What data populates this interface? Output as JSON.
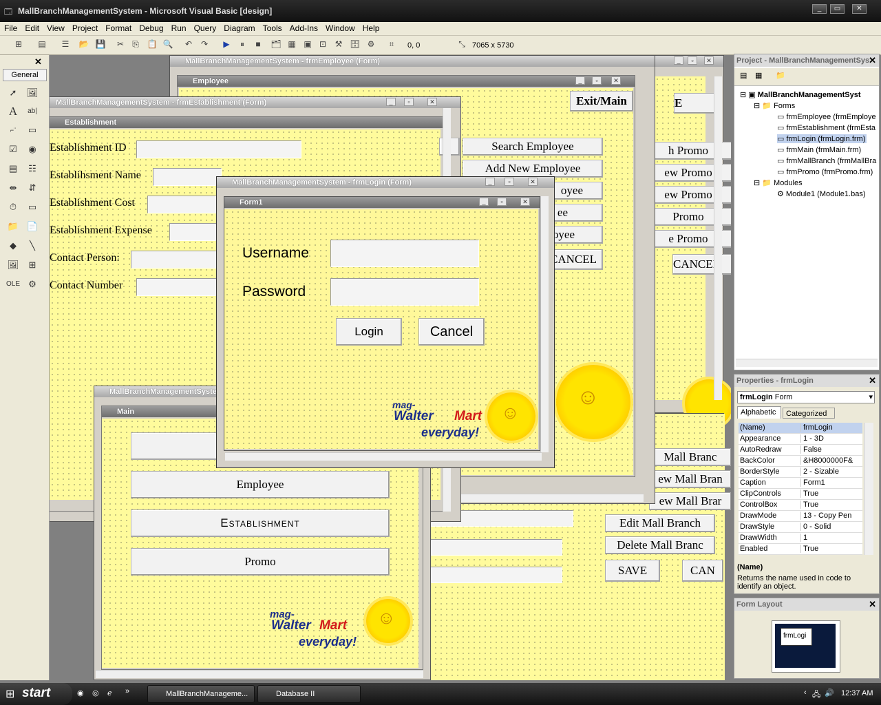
{
  "app": {
    "title": "MallBranchManagementSystem - Microsoft Visual Basic [design]"
  },
  "menu": [
    "File",
    "Edit",
    "View",
    "Project",
    "Format",
    "Debug",
    "Run",
    "Query",
    "Diagram",
    "Tools",
    "Add-Ins",
    "Window",
    "Help"
  ],
  "toolbar": {
    "position": "0, 0",
    "size": "7065 x 5730"
  },
  "toolbox": {
    "title": "General"
  },
  "windows": {
    "employee": {
      "mdi_title": "MallBranchManagementSystem - frmEmployee (Form)",
      "title": "Employee",
      "exit_label": "Exit/Main",
      "buttons": [
        "Search Employee",
        "Add New Employee",
        "oyee",
        "ee",
        "oyee",
        "CANCEL"
      ]
    },
    "promo": {
      "buttons": [
        "h Promo",
        "ew Promo",
        "ew Promo",
        "Promo",
        "e Promo",
        "CANCEI"
      ],
      "b_label": "E"
    },
    "mallbranch": {
      "buttons": [
        "Mall Branc",
        "ew Mall Bran",
        "ew Mall Brar",
        "Edit Mall Branch",
        "Delete Mall Branc",
        "SAVE",
        "CAN"
      ]
    },
    "establishment": {
      "mdi_title": "MallBranchManagementSystem - frmEstablishment (Form)",
      "title": "Establishment",
      "fields": [
        "Establishment ID",
        "Establihsment Name",
        "Establishment Cost",
        "Establishment Expense",
        "Contact Person:",
        "Contact Number"
      ],
      "b_label": "E"
    },
    "main": {
      "mdi_title": "MallBranchManagementSyste",
      "title": "Main",
      "buttons": [
        "Employee",
        "Establishment",
        "Promo"
      ]
    },
    "login": {
      "mdi_title": "MallBranchManagementSystem - frmLogin (Form)",
      "title": "Form1",
      "username_label": "Username",
      "password_label": "Password",
      "login_label": "Login",
      "cancel_label": "Cancel"
    }
  },
  "logo": {
    "line1": "mag-",
    "line2a": "Walter",
    "line2b": "Mart",
    "line3": "everyday!"
  },
  "project": {
    "title": "Project - MallBranchManagementSys",
    "root": "MallBranchManagementSyst",
    "forms_label": "Forms",
    "forms": [
      "frmEmployee (frmEmploye",
      "frmEstablishment (frmEsta",
      "frmLogin (frmLogin.frm)",
      "frmMain (frmMain.frm)",
      "frmMallBranch (frmMallBra",
      "frmPromo (frmPromo.frm)"
    ],
    "selected_index": 2,
    "modules_label": "Modules",
    "modules": [
      "Module1 (Module1.bas)"
    ]
  },
  "properties": {
    "title": "Properties - frmLogin",
    "object": "frmLogin",
    "object_type": "Form",
    "tabs": [
      "Alphabetic",
      "Categorized"
    ],
    "rows": [
      {
        "name": "(Name)",
        "value": "frmLogin"
      },
      {
        "name": "Appearance",
        "value": "1 - 3D"
      },
      {
        "name": "AutoRedraw",
        "value": "False"
      },
      {
        "name": "BackColor",
        "value": "&H8000000F&"
      },
      {
        "name": "BorderStyle",
        "value": "2 - Sizable"
      },
      {
        "name": "Caption",
        "value": "Form1"
      },
      {
        "name": "ClipControls",
        "value": "True"
      },
      {
        "name": "ControlBox",
        "value": "True"
      },
      {
        "name": "DrawMode",
        "value": "13 - Copy Pen"
      },
      {
        "name": "DrawStyle",
        "value": "0 - Solid"
      },
      {
        "name": "DrawWidth",
        "value": "1"
      },
      {
        "name": "Enabled",
        "value": "True"
      }
    ],
    "desc_title": "(Name)",
    "desc_text": "Returns the name used in code to identify an object."
  },
  "form_layout": {
    "title": "Form Layout",
    "thumb_label": "frmLogi"
  },
  "taskbar": {
    "start": "start",
    "tasks": [
      "MallBranchManageme...",
      "Database II"
    ],
    "clock": "12:37 AM"
  },
  "colors": {
    "form_yellow": "#fffb9c",
    "selection": "#c1d2ee"
  }
}
